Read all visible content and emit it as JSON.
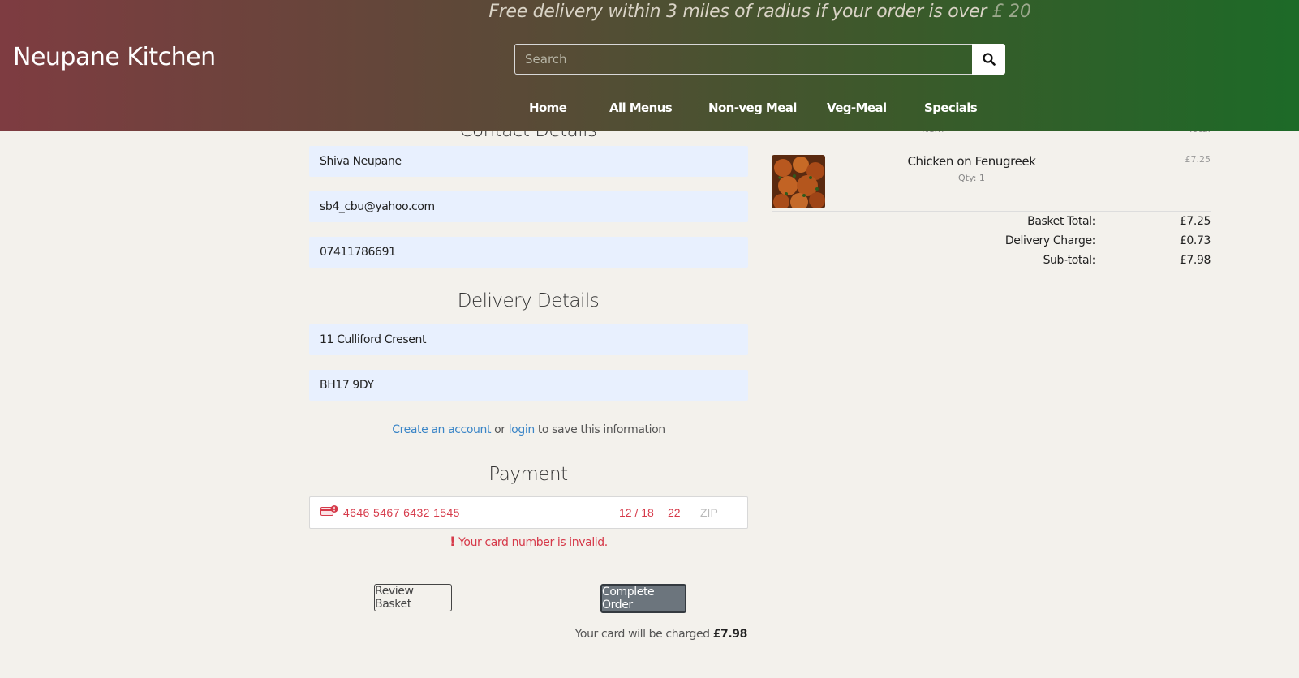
{
  "header": {
    "promo_text": "Free delivery within 3 miles of radius if your order is over",
    "promo_amount": "£ 20",
    "brand": "Neupane Kitchen",
    "search_placeholder": "Search",
    "nav": [
      "Home",
      "All Menus",
      "Non-veg Meal",
      "Veg-Meal",
      "Specials"
    ]
  },
  "contact": {
    "title": "Contact Details",
    "full_name": "Shiva Neupane",
    "email": "sb4_cbu@yahoo.com",
    "phone": "07411786691"
  },
  "delivery": {
    "title": "Delivery Details",
    "address": "11 Culliford Cresent",
    "postcode": "BH17 9DY"
  },
  "account_prompt": {
    "create_link": "Create an account",
    "or": " or ",
    "login_link": "login",
    "suffix": " to save this information"
  },
  "payment": {
    "title": "Payment",
    "card_number": "4646 5467 6432 1545",
    "expiry": "12 / 18",
    "cvc": "22",
    "zip_placeholder": "ZIP",
    "error": "Your card number is invalid.",
    "error_icon": "!"
  },
  "actions": {
    "review_basket": "Review Basket",
    "complete_order": "Complete Order",
    "charge_prefix": "Your card will be charged ",
    "charge_amount": "£7.98"
  },
  "basket": {
    "col_item": "Item",
    "col_total": "Total",
    "items": [
      {
        "name": "Chicken on Fenugreek",
        "qty": "Qty: 1",
        "price": "£7.25"
      }
    ],
    "summary": [
      {
        "label": "Basket Total:",
        "value": "£7.25"
      },
      {
        "label": "Delivery Charge:",
        "value": "£0.73"
      },
      {
        "label": "Sub-total:",
        "value": "£7.98"
      }
    ]
  },
  "colors": {
    "header_gradient_start": "#7e3c41",
    "header_gradient_end": "#1d6a28",
    "error_red": "#d63a4a",
    "link_blue": "#3a85c7",
    "field_bg": "#e8f0fe",
    "page_bg": "#f3f1ec"
  }
}
